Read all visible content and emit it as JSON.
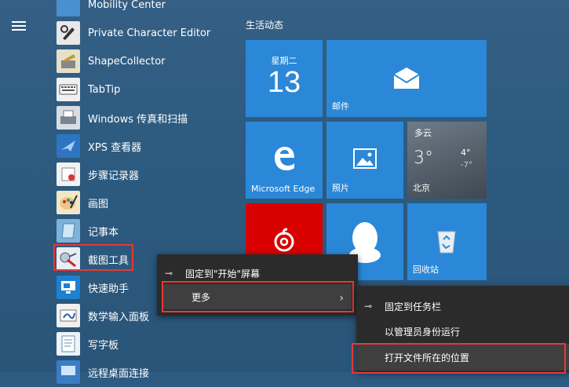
{
  "menu_icon": "hamburger-icon",
  "apps": [
    {
      "label": "Mobility Center",
      "icon": "mobility-center-icon"
    },
    {
      "label": "Private Character Editor",
      "icon": "private-character-editor-icon"
    },
    {
      "label": "ShapeCollector",
      "icon": "shape-collector-icon"
    },
    {
      "label": "TabTip",
      "icon": "keyboard-icon"
    },
    {
      "label": "Windows 传真和扫描",
      "icon": "fax-scan-icon"
    },
    {
      "label": "XPS 查看器",
      "icon": "xps-viewer-icon"
    },
    {
      "label": "步骤记录器",
      "icon": "steps-recorder-icon"
    },
    {
      "label": "画图",
      "icon": "paint-icon"
    },
    {
      "label": "记事本",
      "icon": "notepad-icon"
    },
    {
      "label": "截图工具",
      "icon": "snipping-tool-icon"
    },
    {
      "label": "快速助手",
      "icon": "quick-assist-icon"
    },
    {
      "label": "数学输入面板",
      "icon": "math-input-icon"
    },
    {
      "label": "写字板",
      "icon": "wordpad-icon"
    },
    {
      "label": "远程桌面连接",
      "icon": "remote-desktop-icon"
    }
  ],
  "tiles_section_title": "生活动态",
  "tiles": {
    "calendar": {
      "weekday": "星期二",
      "day": "13"
    },
    "mail": {
      "label": "邮件"
    },
    "edge": {
      "label": "Microsoft Edge"
    },
    "photos": {
      "label": "照片"
    },
    "weather": {
      "condition": "多云",
      "temp": "3°",
      "high": "4°",
      "low": "-7°",
      "city": "北京"
    },
    "netease": {
      "label": ""
    },
    "qq": {
      "label": ""
    },
    "recycle": {
      "label": "回收站"
    }
  },
  "context_menu": {
    "items": [
      {
        "label": "固定到\"开始\"屏幕",
        "icon": "pin-icon"
      },
      {
        "label": "更多",
        "icon": ""
      }
    ]
  },
  "submenu": {
    "items": [
      {
        "label": "固定到任务栏",
        "icon": "pin-icon"
      },
      {
        "label": "以管理员身份运行",
        "icon": ""
      },
      {
        "label": "打开文件所在的位置",
        "icon": ""
      }
    ]
  },
  "colors": {
    "tile_blue": "#2b88d8",
    "tile_red": "#d90000",
    "highlight_red": "#e53935",
    "menu_bg": "#2b2b2b",
    "menu_hover": "#3f3f3f"
  }
}
